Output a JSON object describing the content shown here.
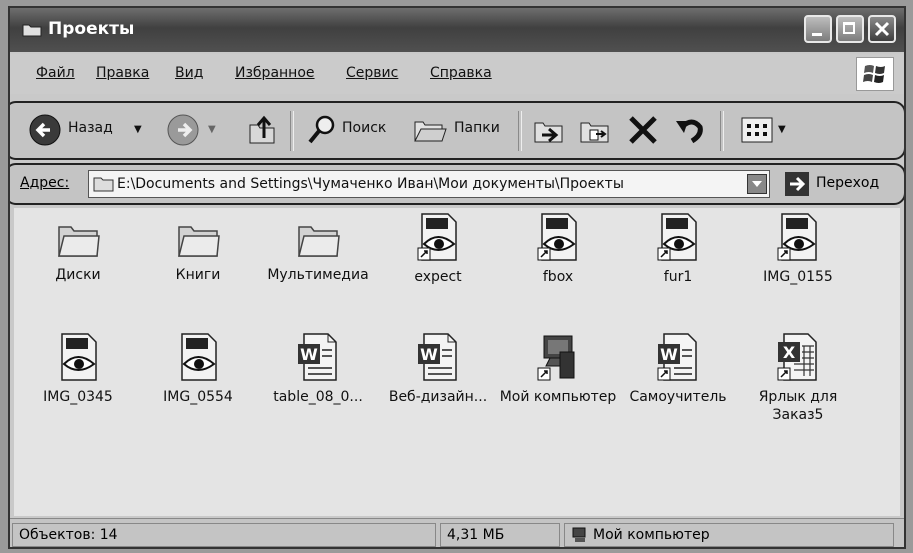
{
  "window": {
    "title": "Проекты"
  },
  "menu": [
    "Файл",
    "Правка",
    "Вид",
    "Избранное",
    "Сервис",
    "Справка"
  ],
  "toolbar": {
    "back_label": "Назад",
    "search_label": "Поиск",
    "folders_label": "Папки"
  },
  "address": {
    "label": "Адрес:",
    "path": "E:\\Documents and Settings\\Чумаченко Иван\\Мои документы\\Проекты",
    "go_label": "Переход"
  },
  "items": [
    {
      "label": "Диски",
      "icon": "folder-icon"
    },
    {
      "label": "Книги",
      "icon": "folder-icon"
    },
    {
      "label": "Мультимедиа",
      "icon": "folder-icon"
    },
    {
      "label": "expect",
      "icon": "eye-image-shortcut-icon"
    },
    {
      "label": "fbox",
      "icon": "eye-image-shortcut-icon"
    },
    {
      "label": "fur1",
      "icon": "eye-image-shortcut-icon"
    },
    {
      "label": "IMG_0155",
      "icon": "eye-image-shortcut-icon"
    },
    {
      "label": "IMG_0345",
      "icon": "eye-image-icon"
    },
    {
      "label": "IMG_0554",
      "icon": "eye-image-icon"
    },
    {
      "label": "table_08_0...",
      "icon": "word-document-icon"
    },
    {
      "label": "Веб-дизайн...",
      "icon": "word-document-icon"
    },
    {
      "label": "Мой компьютер",
      "icon": "computer-shortcut-icon"
    },
    {
      "label": "Самоучитель",
      "icon": "word-document-shortcut-icon"
    },
    {
      "label": "Ярлык для Заказ5",
      "icon": "excel-shortcut-icon"
    }
  ],
  "status": {
    "objects": "Объектов: 14",
    "size": "4,31 МБ",
    "location": "Мой компьютер"
  }
}
